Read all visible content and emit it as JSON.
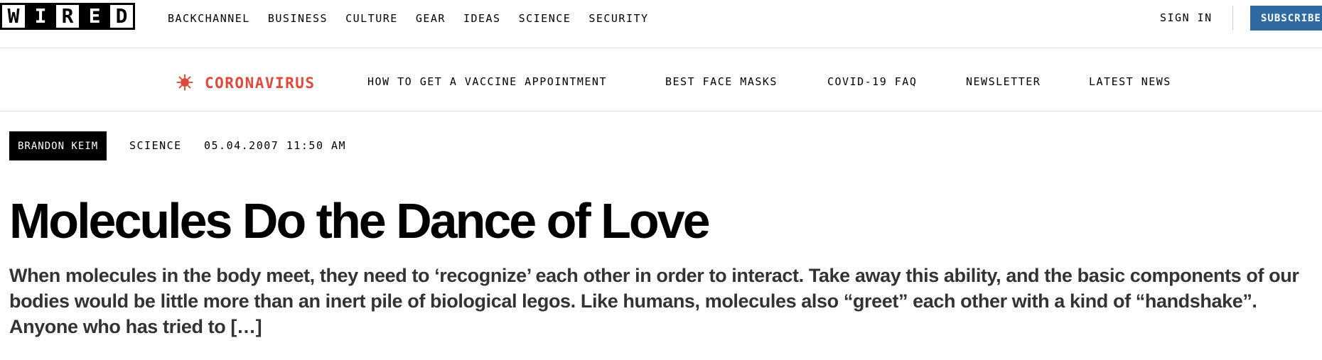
{
  "logo": {
    "alt": "WIRED",
    "letters": [
      "W",
      "I",
      "R",
      "E",
      "D"
    ]
  },
  "nav": {
    "items": [
      "BACKCHANNEL",
      "BUSINESS",
      "CULTURE",
      "GEAR",
      "IDEAS",
      "SCIENCE",
      "SECURITY"
    ],
    "sign_in": "SIGN IN",
    "subscribe": "SUBSCRIBE"
  },
  "covid_bar": {
    "label": "CORONAVIRUS",
    "links": [
      "HOW TO GET A VACCINE APPOINTMENT",
      "BEST FACE MASKS",
      "COVID-19 FAQ",
      "NEWSLETTER",
      "LATEST NEWS"
    ]
  },
  "article": {
    "author": "BRANDON KEIM",
    "section": "SCIENCE",
    "date": "05.04.2007 11:50 AM",
    "headline": "Molecules Do the Dance of Love",
    "dek": "When molecules in the body meet, they need to ‘recognize’ each other in order to interact. Take away this ability, and the basic components of our bodies would be little more than an inert pile of biological legos. Like humans, molecules also “greet” each other with a kind of “handshake”. Anyone who has tried to […]"
  },
  "colors": {
    "subscribe_bg": "#2f6aa3",
    "coronavirus_red": "#e04a3a",
    "byline_bg": "#000000",
    "dek_text": "#333333"
  },
  "icons": {
    "covid": "virus-icon"
  }
}
